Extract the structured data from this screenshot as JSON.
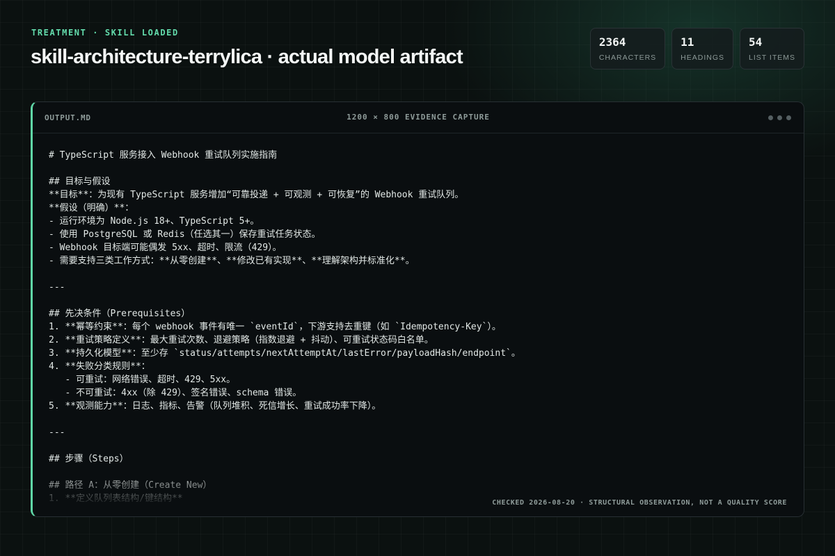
{
  "header": {
    "eyebrow": "TREATMENT · SKILL LOADED",
    "title": "skill-architecture-terrylica · actual model artifact"
  },
  "stats": [
    {
      "value": "2364",
      "label": "CHARACTERS"
    },
    {
      "value": "11",
      "label": "HEADINGS"
    },
    {
      "value": "54",
      "label": "LIST ITEMS"
    }
  ],
  "panel": {
    "file_name": "OUTPUT.MD",
    "capture_label": "1200 × 800 EVIDENCE CAPTURE",
    "footer_note": "CHECKED 2026-08-20 · STRUCTURAL OBSERVATION, NOT A QUALITY SCORE",
    "lines": [
      "# TypeScript 服务接入 Webhook 重试队列实施指南",
      "",
      "## 目标与假设",
      "**目标**：为现有 TypeScript 服务增加“可靠投递 + 可观测 + 可恢复”的 Webhook 重试队列。",
      "**假设（明确）**：",
      "- 运行环境为 Node.js 18+、TypeScript 5+。",
      "- 使用 PostgreSQL 或 Redis（任选其一）保存重试任务状态。",
      "- Webhook 目标端可能偶发 5xx、超时、限流（429）。",
      "- 需要支持三类工作方式：**从零创建**、**修改已有实现**、**理解架构并标准化**。",
      "",
      "---",
      "",
      "## 先决条件（Prerequisites）",
      "1. **幂等约束**：每个 webhook 事件有唯一 `eventId`，下游支持去重键（如 `Idempotency-Key`）。",
      "2. **重试策略定义**：最大重试次数、退避策略（指数退避 + 抖动）、可重试状态码白名单。",
      "3. **持久化模型**：至少存 `status/attempts/nextAttemptAt/lastError/payloadHash/endpoint`。",
      "4. **失败分类规则**：",
      "   - 可重试：网络错误、超时、429、5xx。",
      "   - 不可重试：4xx（除 429）、签名错误、schema 错误。",
      "5. **观测能力**：日志、指标、告警（队列堆积、死信增长、重试成功率下降）。",
      "",
      "---",
      "",
      "## 步骤（Steps）",
      "",
      "## 路径 A：从零创建（Create New）",
      "1. **定义队列表结构/键结构**"
    ]
  }
}
